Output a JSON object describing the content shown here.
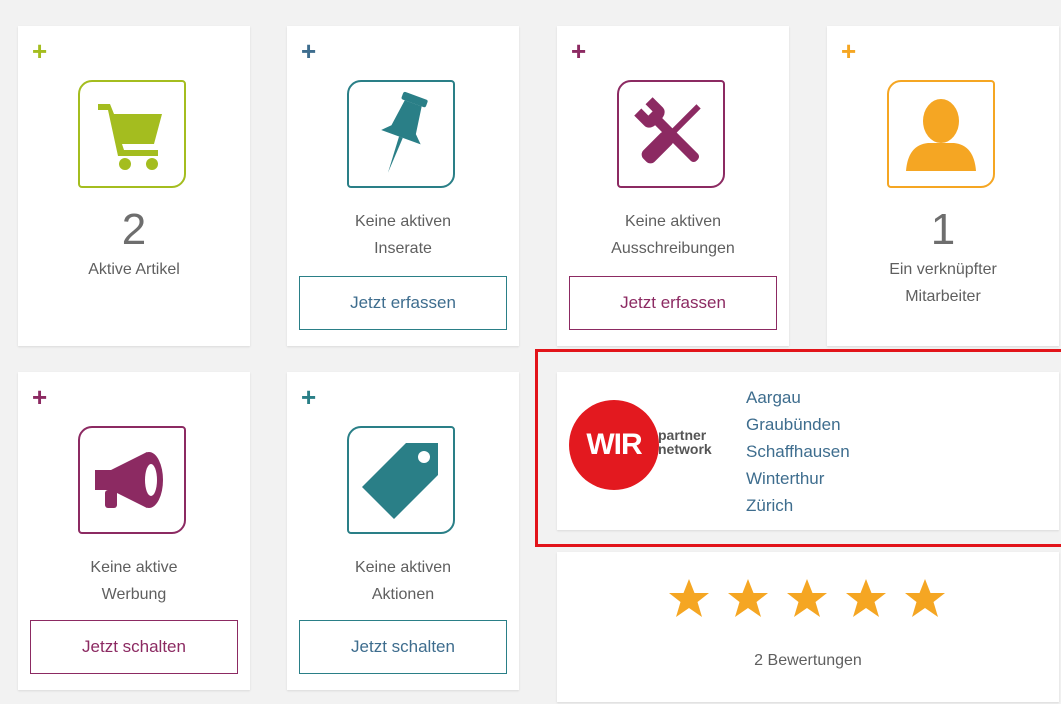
{
  "colors": {
    "green": "#a4bd1f",
    "blue": "#2a7f87",
    "purple": "#8c2a62",
    "orange": "#f5a623",
    "text": "#5f5f5f",
    "link": "#3e6d8e",
    "highlight": "#e2141a",
    "wir_red": "#e3191f",
    "star": "#f5a623"
  },
  "cards": {
    "articles": {
      "plus": "+",
      "icon": "shopping-cart-icon",
      "count": "2",
      "label": "Aktive Artikel"
    },
    "ads": {
      "plus": "+",
      "icon": "pushpin-icon",
      "label_line1": "Keine aktiven",
      "label_line2": "Inserate",
      "button": "Jetzt erfassen"
    },
    "tenders": {
      "plus": "+",
      "icon": "tools-icon",
      "label_line1": "Keine aktiven",
      "label_line2": "Ausschreibungen",
      "button": "Jetzt erfassen"
    },
    "employees": {
      "plus": "+",
      "icon": "user-icon",
      "count": "1",
      "label_line1": "Ein verknüpfter",
      "label_line2": "Mitarbeiter"
    },
    "advertising": {
      "plus": "+",
      "icon": "megaphone-icon",
      "label_line1": "Keine aktive",
      "label_line2": "Werbung",
      "button": "Jetzt schalten"
    },
    "promotions": {
      "plus": "+",
      "icon": "price-tag-icon",
      "label_line1": "Keine aktiven",
      "label_line2": "Aktionen",
      "button": "Jetzt schalten"
    }
  },
  "partner": {
    "logo_text": "WIR",
    "logo_caption_line1": "partner",
    "logo_caption_line2": "network",
    "regions": [
      "Aargau",
      "Graubünden",
      "Schaffhausen",
      "Winterthur",
      "Zürich"
    ]
  },
  "rating": {
    "stars": 5,
    "max_stars": 5,
    "reviews": "2 Bewertungen"
  }
}
